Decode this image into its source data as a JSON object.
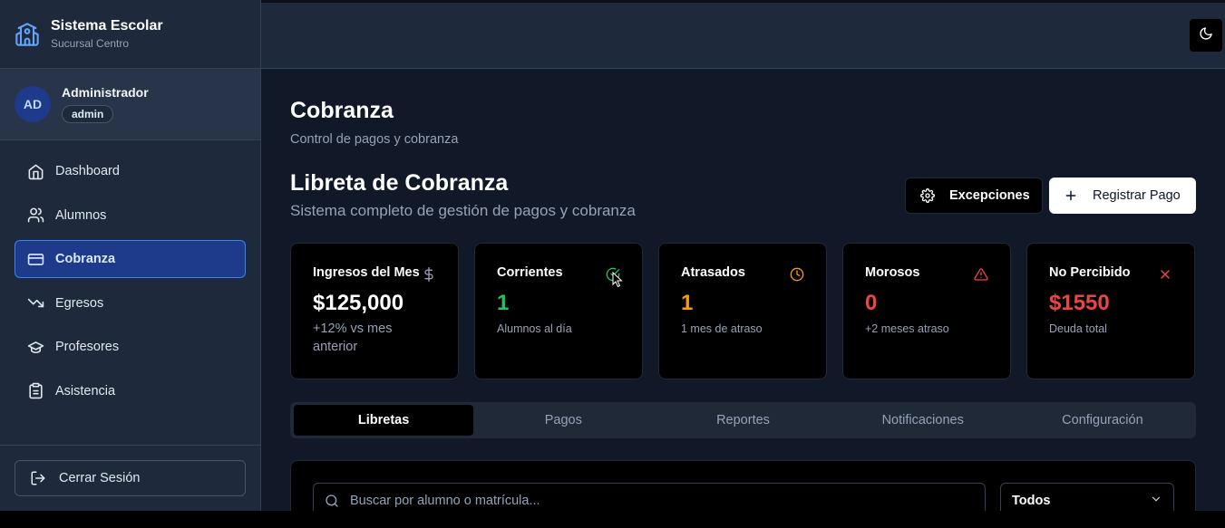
{
  "brand": {
    "title": "Sistema Escolar",
    "subtitle": "Sucursal Centro"
  },
  "user": {
    "initials": "AD",
    "name": "Administrador",
    "role": "admin"
  },
  "nav": [
    {
      "label": "Dashboard",
      "icon": "home-icon"
    },
    {
      "label": "Alumnos",
      "icon": "users-icon"
    },
    {
      "label": "Cobranza",
      "icon": "credit-card-icon",
      "active": true
    },
    {
      "label": "Egresos",
      "icon": "trending-down-icon"
    },
    {
      "label": "Profesores",
      "icon": "graduation-cap-icon"
    },
    {
      "label": "Asistencia",
      "icon": "clipboard-icon"
    }
  ],
  "logout_label": "Cerrar Sesión",
  "topbar": {
    "theme_icon": "moon-icon"
  },
  "page": {
    "title": "Cobranza",
    "subtitle": "Control de pagos y cobranza"
  },
  "section": {
    "title": "Libreta de Cobranza",
    "subtitle": "Sistema completo de gestión de pagos y cobranza",
    "exceptions_label": "Excepciones",
    "register_label": "Registrar Pago"
  },
  "cards": [
    {
      "label": "Ingresos del Mes",
      "value": "$125,000",
      "note": "+12% vs mes anterior",
      "icon": "dollar-icon",
      "color": "#ffffff"
    },
    {
      "label": "Corrientes",
      "value": "1",
      "note": "Alumnos al día",
      "icon": "check-circle-icon",
      "color": "#22c55e"
    },
    {
      "label": "Atrasados",
      "value": "1",
      "note": "1 mes de atraso",
      "icon": "clock-icon",
      "color": "#f59e0b"
    },
    {
      "label": "Morosos",
      "value": "0",
      "note": "+2 meses atraso",
      "icon": "alert-triangle-icon",
      "color": "#ef4444"
    },
    {
      "label": "No Percibido",
      "value": "$1550",
      "note": "Deuda total",
      "icon": "x-icon",
      "color": "#ef4444"
    }
  ],
  "tabs": [
    "Libretas",
    "Pagos",
    "Reportes",
    "Notificaciones",
    "Configuración"
  ],
  "active_tab": "Libretas",
  "search": {
    "placeholder": "Buscar por alumno o matrícula..."
  },
  "filter": {
    "selected": "Todos"
  }
}
